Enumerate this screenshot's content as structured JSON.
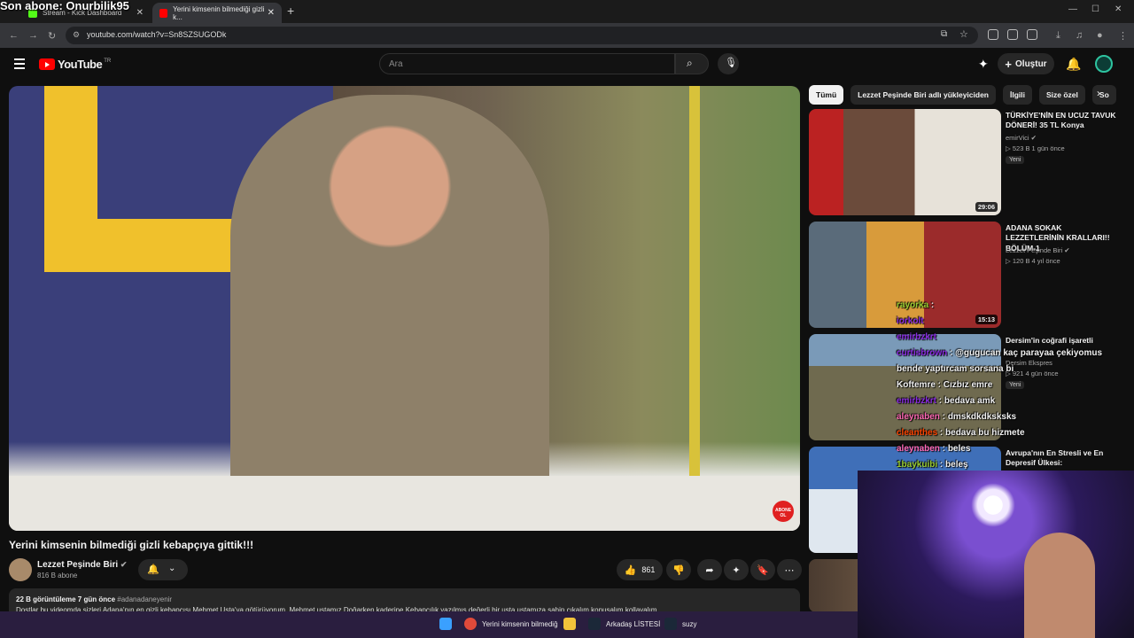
{
  "browser": {
    "tabs": [
      {
        "label": "Stream - Kick Dashboard"
      },
      {
        "label": "Yerini kimsenin bilmediği gizli k..."
      }
    ],
    "url": "youtube.com/watch?v=Sn8SZSUGODk"
  },
  "overlay": {
    "last_sub": "Son abone: Onurbilik95"
  },
  "header": {
    "logo": "YouTube",
    "country": "TR",
    "search_placeholder": "Ara",
    "create_label": "Oluştur"
  },
  "video": {
    "title": "Yerini kimsenin bilmediği gizli kebapçıya gittik!!!",
    "channel": "Lezzet Peşinde Biri",
    "subscribers": "816 B abone",
    "likes": "861",
    "subscribe_badge": "ABONE OL",
    "stats": "22 B görüntüleme  7 gün önce",
    "hashtag": "#adanadaneyenir",
    "description": "Dostlar bu videomda sizleri Adana'nın en gizli kebapçısı Mehmet Usta'ya götürüyorum. Mehmet ustamız Doğarken kaderine Kebapçılık yazılmış değerli bir usta ustamıza sahip çıkalım konuşalım kollayalım"
  },
  "chips": [
    "Tümü",
    "Lezzet Peşinde Biri adlı yükleyiciden",
    "İlgili",
    "Size özel",
    "So"
  ],
  "recommendations": [
    {
      "title": "TÜRKİYE'NİN EN UCUZ TAVUK DÖNERİ! 35 TL Konya",
      "channel": "emirVici",
      "meta": "523 B  1 gün önce",
      "badge": "Yeni",
      "duration": "29:06"
    },
    {
      "title": "ADANA SOKAK LEZZETLERİNİN KRALLARI!! BÖLÜM-1",
      "channel": "Lezzet Peşinde Biri",
      "meta": "120 B  4 yıl önce",
      "badge": "",
      "duration": "15:13"
    },
    {
      "title": "Dersim'in coğrafi işaretli",
      "channel": "Dersim Ekspres",
      "meta": "921  4 gün önce",
      "badge": "Yeni",
      "duration": ""
    },
    {
      "title": "Avrupa'nın En Stresli ve En Depresif Ülkesi:",
      "channel": "",
      "meta": "",
      "badge": "",
      "duration": ""
    }
  ],
  "chat": [
    {
      "user": "rayorka",
      "msg": "",
      "color": "#9acd32"
    },
    {
      "user": "iorkolt",
      "msg": "",
      "color": "#8a2be2"
    },
    {
      "user": "emirbzkrt",
      "msg": "",
      "color": "#8a2be2"
    },
    {
      "user": "curtisbrown",
      "msg": "@gugucan kaç parayaa çekiyomus",
      "color": "#8a2be2"
    },
    {
      "user": "",
      "msg": "bende yaptırcam sorsana bi",
      "color": "#ffffff"
    },
    {
      "user": "Koftemre",
      "msg": "Cızbız emre",
      "color": "#ffffff"
    },
    {
      "user": "emirbzkrt",
      "msg": "bedava amk",
      "color": "#8a2be2"
    },
    {
      "user": "aleynaben",
      "msg": "dmskdkdksksks",
      "color": "#ff69b4"
    },
    {
      "user": "cleanthes",
      "msg": "bedava bu hizmete",
      "color": "#ff4500"
    },
    {
      "user": "aleynaben",
      "msg": "beles",
      "color": "#ff69b4"
    },
    {
      "user": "1baykuibi",
      "msg": "beleş",
      "color": "#9acd32"
    }
  ],
  "taskbar": [
    {
      "label": "Yerini kimsenin bilmediğ"
    },
    {
      "label": "Arkadaş LİSTESİ"
    },
    {
      "label": "suzy"
    }
  ],
  "colors": {
    "yt_red": "#ff0000",
    "bg": "#0f0f0f",
    "surface": "#272727"
  }
}
